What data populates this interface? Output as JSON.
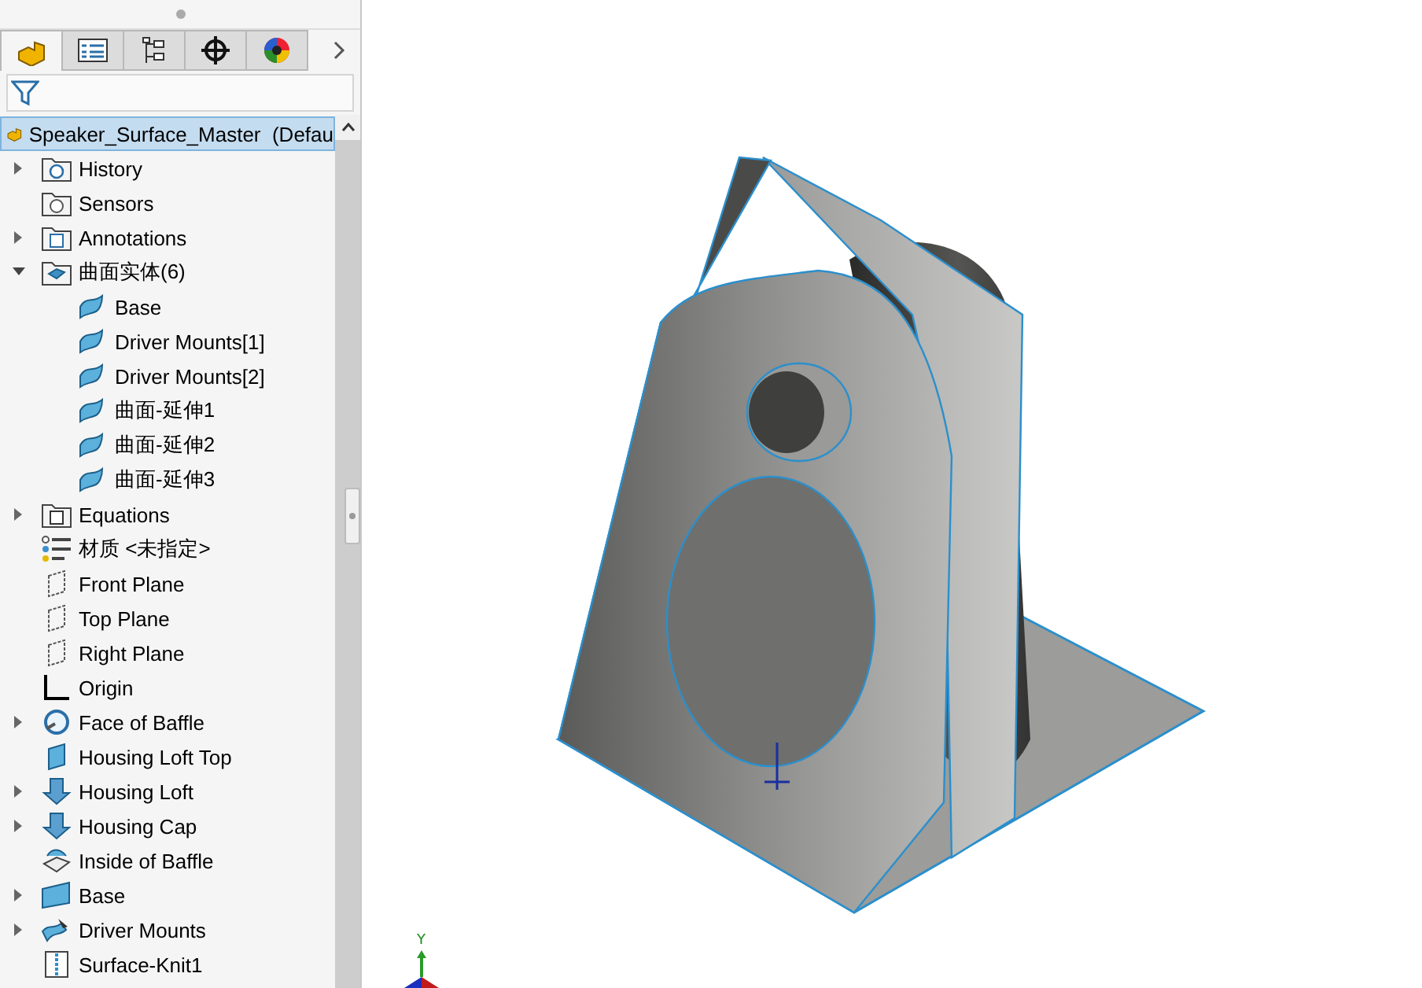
{
  "panel_tabs": [
    {
      "kind": "feature-tree",
      "selected": true
    },
    {
      "kind": "property",
      "selected": false
    },
    {
      "kind": "configuration",
      "selected": false
    },
    {
      "kind": "dimxpert",
      "selected": false
    },
    {
      "kind": "display",
      "selected": false
    }
  ],
  "tree": {
    "root": {
      "label": "Speaker_Surface_Master  (Defau",
      "selected": true
    },
    "items": [
      {
        "label": "History",
        "kind": "history",
        "expanded": false
      },
      {
        "label": "Sensors",
        "kind": "sensors"
      },
      {
        "label": "Annotations",
        "kind": "annotations",
        "expanded": false
      },
      {
        "label": "曲面实体(6)",
        "kind": "bodies",
        "expanded": true,
        "children": [
          {
            "label": "Base",
            "kind": "surface"
          },
          {
            "label": "Driver Mounts[1]",
            "kind": "surface"
          },
          {
            "label": "Driver Mounts[2]",
            "kind": "surface"
          },
          {
            "label": "曲面-延伸1",
            "kind": "surface"
          },
          {
            "label": "曲面-延伸2",
            "kind": "surface"
          },
          {
            "label": "曲面-延伸3",
            "kind": "surface"
          }
        ]
      },
      {
        "label": "Equations",
        "kind": "equations",
        "expanded": false
      },
      {
        "label": "材质 <未指定>",
        "kind": "material"
      },
      {
        "label": "Front Plane",
        "kind": "plane"
      },
      {
        "label": "Top Plane",
        "kind": "plane"
      },
      {
        "label": "Right Plane",
        "kind": "plane"
      },
      {
        "label": "Origin",
        "kind": "origin"
      },
      {
        "label": "Face of Baffle",
        "kind": "revolve",
        "expanded": false
      },
      {
        "label": "Housing Loft Top",
        "kind": "planar"
      },
      {
        "label": "Housing Loft",
        "kind": "loft",
        "expanded": false
      },
      {
        "label": "Housing Cap",
        "kind": "loft",
        "expanded": false
      },
      {
        "label": "Inside of Baffle",
        "kind": "fill"
      },
      {
        "label": "Base",
        "kind": "base",
        "expanded": false
      },
      {
        "label": "Driver Mounts",
        "kind": "extend",
        "expanded": false
      },
      {
        "label": "Surface-Knit1",
        "kind": "knit"
      }
    ]
  },
  "triad": {
    "axis_label": "Y"
  }
}
